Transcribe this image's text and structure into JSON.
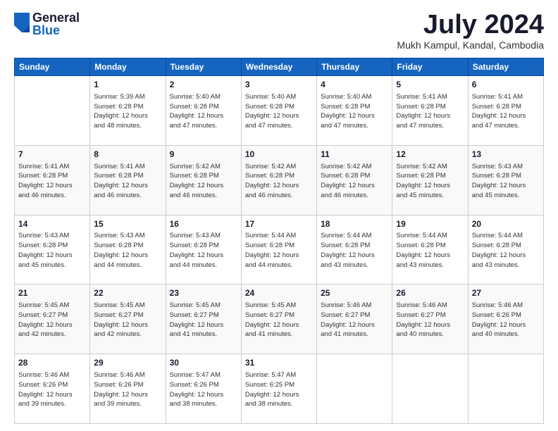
{
  "header": {
    "logo_general": "General",
    "logo_blue": "Blue",
    "month_title": "July 2024",
    "location": "Mukh Kampul, Kandal, Cambodia"
  },
  "weekdays": [
    "Sunday",
    "Monday",
    "Tuesday",
    "Wednesday",
    "Thursday",
    "Friday",
    "Saturday"
  ],
  "weeks": [
    [
      {
        "day": "",
        "sunrise": "",
        "sunset": "",
        "daylight": "",
        "extra": ""
      },
      {
        "day": "1",
        "sunrise": "Sunrise: 5:39 AM",
        "sunset": "Sunset: 6:28 PM",
        "daylight": "Daylight: 12 hours",
        "extra": "and 48 minutes."
      },
      {
        "day": "2",
        "sunrise": "Sunrise: 5:40 AM",
        "sunset": "Sunset: 6:28 PM",
        "daylight": "Daylight: 12 hours",
        "extra": "and 47 minutes."
      },
      {
        "day": "3",
        "sunrise": "Sunrise: 5:40 AM",
        "sunset": "Sunset: 6:28 PM",
        "daylight": "Daylight: 12 hours",
        "extra": "and 47 minutes."
      },
      {
        "day": "4",
        "sunrise": "Sunrise: 5:40 AM",
        "sunset": "Sunset: 6:28 PM",
        "daylight": "Daylight: 12 hours",
        "extra": "and 47 minutes."
      },
      {
        "day": "5",
        "sunrise": "Sunrise: 5:41 AM",
        "sunset": "Sunset: 6:28 PM",
        "daylight": "Daylight: 12 hours",
        "extra": "and 47 minutes."
      },
      {
        "day": "6",
        "sunrise": "Sunrise: 5:41 AM",
        "sunset": "Sunset: 6:28 PM",
        "daylight": "Daylight: 12 hours",
        "extra": "and 47 minutes."
      }
    ],
    [
      {
        "day": "7",
        "sunrise": "Sunrise: 5:41 AM",
        "sunset": "Sunset: 6:28 PM",
        "daylight": "Daylight: 12 hours",
        "extra": "and 46 minutes."
      },
      {
        "day": "8",
        "sunrise": "Sunrise: 5:41 AM",
        "sunset": "Sunset: 6:28 PM",
        "daylight": "Daylight: 12 hours",
        "extra": "and 46 minutes."
      },
      {
        "day": "9",
        "sunrise": "Sunrise: 5:42 AM",
        "sunset": "Sunset: 6:28 PM",
        "daylight": "Daylight: 12 hours",
        "extra": "and 46 minutes."
      },
      {
        "day": "10",
        "sunrise": "Sunrise: 5:42 AM",
        "sunset": "Sunset: 6:28 PM",
        "daylight": "Daylight: 12 hours",
        "extra": "and 46 minutes."
      },
      {
        "day": "11",
        "sunrise": "Sunrise: 5:42 AM",
        "sunset": "Sunset: 6:28 PM",
        "daylight": "Daylight: 12 hours",
        "extra": "and 46 minutes."
      },
      {
        "day": "12",
        "sunrise": "Sunrise: 5:42 AM",
        "sunset": "Sunset: 6:28 PM",
        "daylight": "Daylight: 12 hours",
        "extra": "and 45 minutes."
      },
      {
        "day": "13",
        "sunrise": "Sunrise: 5:43 AM",
        "sunset": "Sunset: 6:28 PM",
        "daylight": "Daylight: 12 hours",
        "extra": "and 45 minutes."
      }
    ],
    [
      {
        "day": "14",
        "sunrise": "Sunrise: 5:43 AM",
        "sunset": "Sunset: 6:28 PM",
        "daylight": "Daylight: 12 hours",
        "extra": "and 45 minutes."
      },
      {
        "day": "15",
        "sunrise": "Sunrise: 5:43 AM",
        "sunset": "Sunset: 6:28 PM",
        "daylight": "Daylight: 12 hours",
        "extra": "and 44 minutes."
      },
      {
        "day": "16",
        "sunrise": "Sunrise: 5:43 AM",
        "sunset": "Sunset: 6:28 PM",
        "daylight": "Daylight: 12 hours",
        "extra": "and 44 minutes."
      },
      {
        "day": "17",
        "sunrise": "Sunrise: 5:44 AM",
        "sunset": "Sunset: 6:28 PM",
        "daylight": "Daylight: 12 hours",
        "extra": "and 44 minutes."
      },
      {
        "day": "18",
        "sunrise": "Sunrise: 5:44 AM",
        "sunset": "Sunset: 6:28 PM",
        "daylight": "Daylight: 12 hours",
        "extra": "and 43 minutes."
      },
      {
        "day": "19",
        "sunrise": "Sunrise: 5:44 AM",
        "sunset": "Sunset: 6:28 PM",
        "daylight": "Daylight: 12 hours",
        "extra": "and 43 minutes."
      },
      {
        "day": "20",
        "sunrise": "Sunrise: 5:44 AM",
        "sunset": "Sunset: 6:28 PM",
        "daylight": "Daylight: 12 hours",
        "extra": "and 43 minutes."
      }
    ],
    [
      {
        "day": "21",
        "sunrise": "Sunrise: 5:45 AM",
        "sunset": "Sunset: 6:27 PM",
        "daylight": "Daylight: 12 hours",
        "extra": "and 42 minutes."
      },
      {
        "day": "22",
        "sunrise": "Sunrise: 5:45 AM",
        "sunset": "Sunset: 6:27 PM",
        "daylight": "Daylight: 12 hours",
        "extra": "and 42 minutes."
      },
      {
        "day": "23",
        "sunrise": "Sunrise: 5:45 AM",
        "sunset": "Sunset: 6:27 PM",
        "daylight": "Daylight: 12 hours",
        "extra": "and 41 minutes."
      },
      {
        "day": "24",
        "sunrise": "Sunrise: 5:45 AM",
        "sunset": "Sunset: 6:27 PM",
        "daylight": "Daylight: 12 hours",
        "extra": "and 41 minutes."
      },
      {
        "day": "25",
        "sunrise": "Sunrise: 5:46 AM",
        "sunset": "Sunset: 6:27 PM",
        "daylight": "Daylight: 12 hours",
        "extra": "and 41 minutes."
      },
      {
        "day": "26",
        "sunrise": "Sunrise: 5:46 AM",
        "sunset": "Sunset: 6:27 PM",
        "daylight": "Daylight: 12 hours",
        "extra": "and 40 minutes."
      },
      {
        "day": "27",
        "sunrise": "Sunrise: 5:46 AM",
        "sunset": "Sunset: 6:26 PM",
        "daylight": "Daylight: 12 hours",
        "extra": "and 40 minutes."
      }
    ],
    [
      {
        "day": "28",
        "sunrise": "Sunrise: 5:46 AM",
        "sunset": "Sunset: 6:26 PM",
        "daylight": "Daylight: 12 hours",
        "extra": "and 39 minutes."
      },
      {
        "day": "29",
        "sunrise": "Sunrise: 5:46 AM",
        "sunset": "Sunset: 6:26 PM",
        "daylight": "Daylight: 12 hours",
        "extra": "and 39 minutes."
      },
      {
        "day": "30",
        "sunrise": "Sunrise: 5:47 AM",
        "sunset": "Sunset: 6:26 PM",
        "daylight": "Daylight: 12 hours",
        "extra": "and 38 minutes."
      },
      {
        "day": "31",
        "sunrise": "Sunrise: 5:47 AM",
        "sunset": "Sunset: 6:25 PM",
        "daylight": "Daylight: 12 hours",
        "extra": "and 38 minutes."
      },
      {
        "day": "",
        "sunrise": "",
        "sunset": "",
        "daylight": "",
        "extra": ""
      },
      {
        "day": "",
        "sunrise": "",
        "sunset": "",
        "daylight": "",
        "extra": ""
      },
      {
        "day": "",
        "sunrise": "",
        "sunset": "",
        "daylight": "",
        "extra": ""
      }
    ]
  ]
}
